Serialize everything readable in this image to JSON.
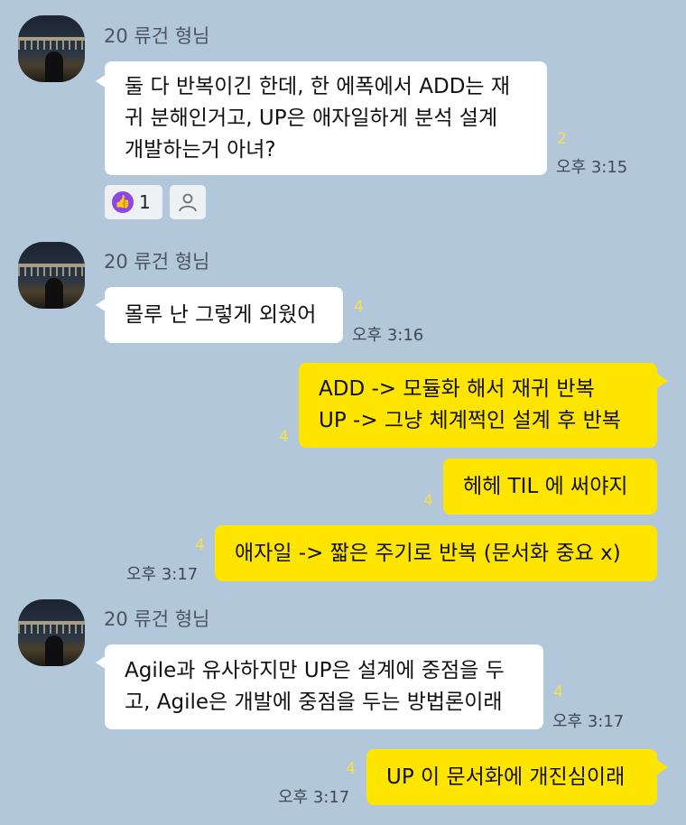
{
  "messages": [
    {
      "sender": "20 류건 형님",
      "lines": [
        "둘 다 반복이긴 한데, 한 에폭에서 ADD는 재",
        "귀 분해인거고, UP은 애자일하게 분석 설계",
        "개발하는거 아녀?"
      ],
      "unread": "2",
      "time": "오후 3:15",
      "reaction_count": "1"
    },
    {
      "sender": "20 류건 형님",
      "lines": [
        "몰루 난 그렇게 외웠어"
      ],
      "unread": "4",
      "time": "오후 3:16"
    },
    {
      "lines": [
        "ADD -> 모듈화 해서 재귀 반복",
        "UP -> 그냥 체계쩍인 설계 후 반복"
      ],
      "unread": "4"
    },
    {
      "lines": [
        "헤헤 TIL 에 써야지"
      ],
      "unread": "4"
    },
    {
      "lines": [
        "애자일 -> 짧은 주기로 반복 (문서화 중요 x)"
      ],
      "unread": "4",
      "time": "오후 3:17"
    },
    {
      "sender": "20 류건 형님",
      "lines": [
        "Agile과 유사하지만 UP은 설계에 중점을 두",
        "고, Agile은 개발에 중점을 두는 방법론이래"
      ],
      "unread": "4",
      "time": "오후 3:17"
    },
    {
      "lines": [
        "UP 이 문서화에 개진심이래"
      ],
      "unread": "4",
      "time": "오후 3:17"
    }
  ],
  "icons": {
    "thumbs_up": "thumbs-up-icon",
    "person": "person-icon"
  },
  "colors": {
    "background": "#b2c7da",
    "my_bubble": "#fee500",
    "their_bubble": "#ffffff",
    "unread": "#f6e04c",
    "reaction": "#8b47e8"
  }
}
